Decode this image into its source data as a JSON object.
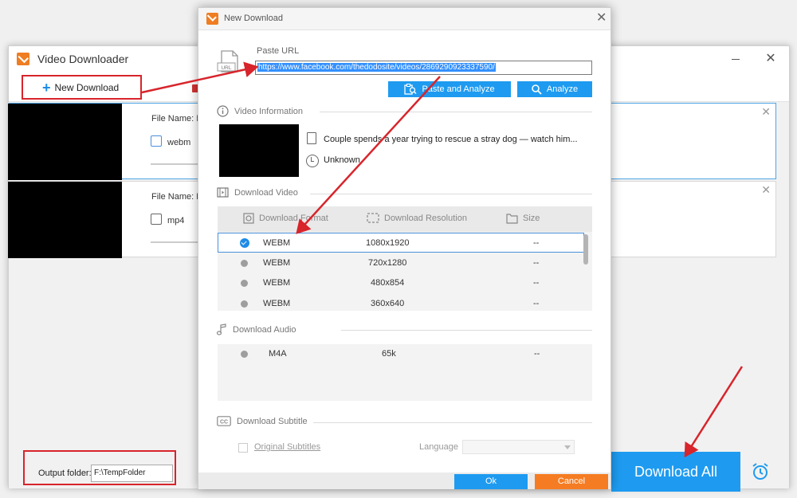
{
  "app": {
    "title": "Video Downloader",
    "new_download_label": "New Download",
    "items": [
      {
        "file_name_label": "File Name: If",
        "format": "webm"
      },
      {
        "file_name_label": "File Name: H",
        "format": "mp4"
      }
    ],
    "output_folder_label": "Output folder:",
    "output_folder_value": "F:\\TempFolder",
    "download_all_label": "Download All"
  },
  "dialog": {
    "title": "New Download",
    "paste_url_label": "Paste URL",
    "url_value": "https://www.facebook.com/thedodosite/videos/2869290923337590/",
    "url_icon_text": "URL",
    "paste_analyze_label": "Paste and Analyze",
    "analyze_label": "Analyze",
    "video_info": {
      "header": "Video Information",
      "title": "Couple spends a year trying to rescue a stray dog — watch him...",
      "duration": "Unknown"
    },
    "download_video": {
      "header": "Download Video",
      "columns": [
        "Download Format",
        "Download Resolution",
        "Size"
      ],
      "rows": [
        {
          "format": "WEBM",
          "resolution": "1080x1920",
          "size": "--",
          "selected": true
        },
        {
          "format": "WEBM",
          "resolution": "720x1280",
          "size": "--",
          "selected": false
        },
        {
          "format": "WEBM",
          "resolution": "480x854",
          "size": "--",
          "selected": false
        },
        {
          "format": "WEBM",
          "resolution": "360x640",
          "size": "--",
          "selected": false
        }
      ]
    },
    "download_audio": {
      "header": "Download Audio",
      "rows": [
        {
          "format": "M4A",
          "bitrate": "65k",
          "size": "--"
        }
      ]
    },
    "download_subtitle": {
      "header": "Download Subtitle",
      "icon_text": "CC",
      "original_subtitles_label": "Original Subtitles",
      "language_label": "Language",
      "language_value": ""
    },
    "ok_label": "Ok",
    "cancel_label": "Cancel"
  },
  "colors": {
    "accent_blue": "#1e9bf0",
    "cancel_orange": "#f57c22",
    "brand_orange": "#ef7d22",
    "annotation_red": "#d8242b"
  }
}
